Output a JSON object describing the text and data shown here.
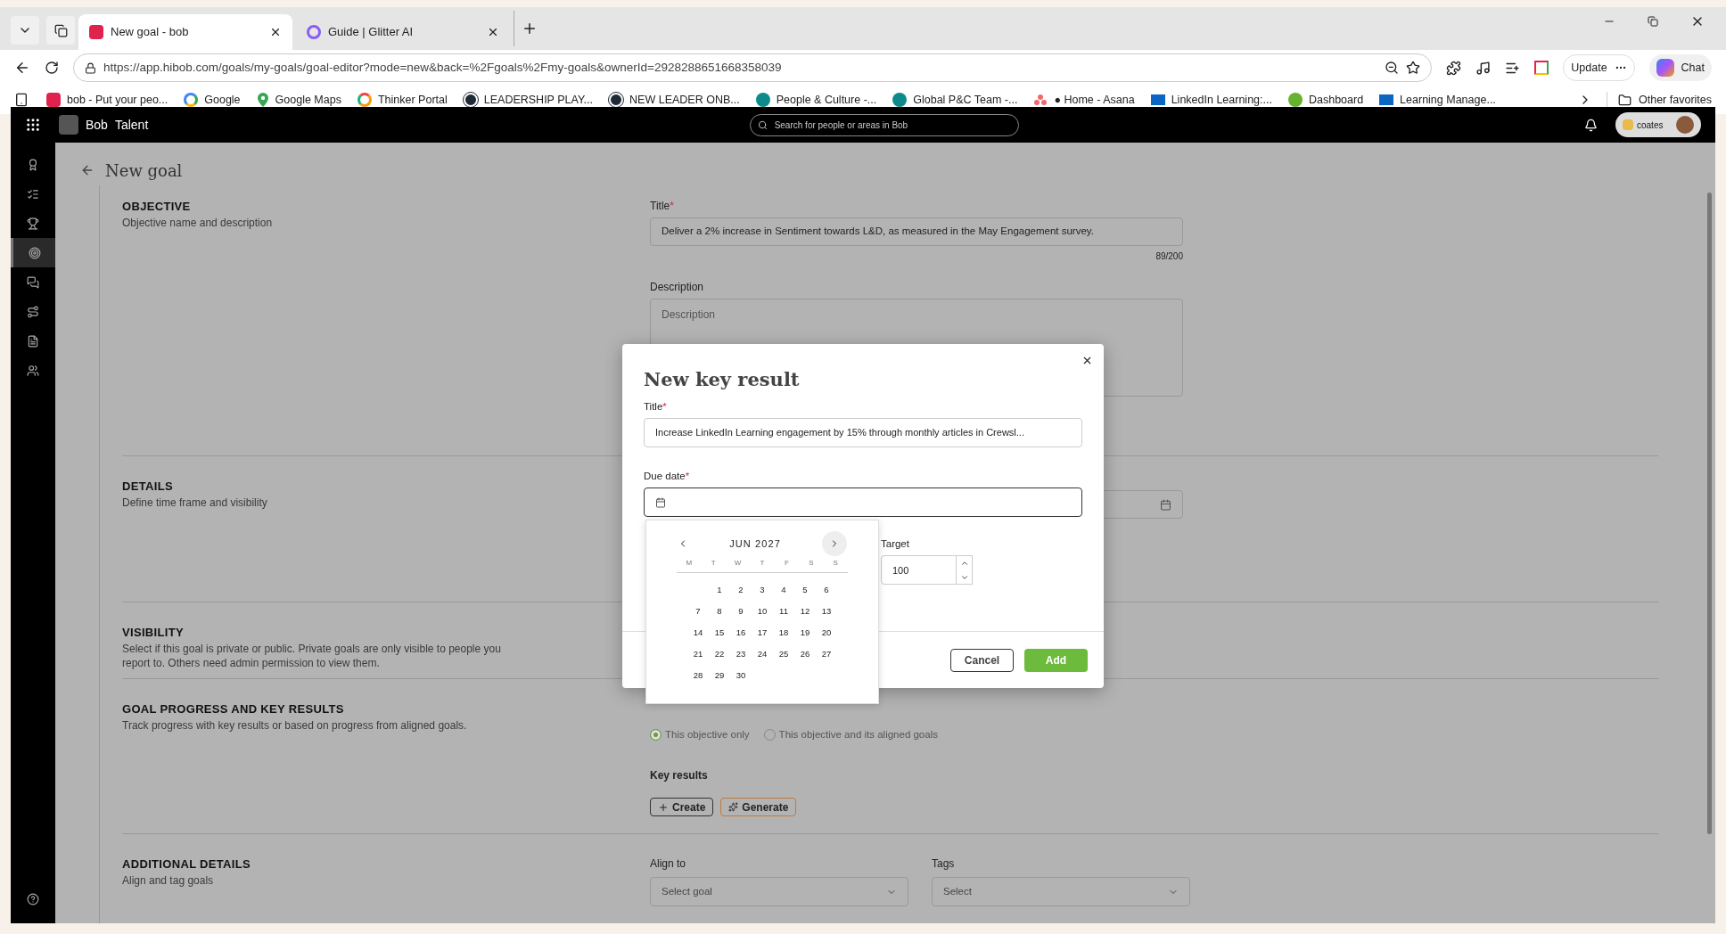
{
  "browser": {
    "tabs": [
      {
        "title": "New goal - bob",
        "selected": true,
        "kind": "bob"
      },
      {
        "title": "Guide | Glitter AI",
        "selected": false,
        "kind": "glitter"
      }
    ],
    "url": "https://app.hibob.com/goals/my-goals/goal-editor?mode=new&back=%2Fgoals%2Fmy-goals&ownerId=2928288651668358039",
    "bookmarks": [
      {
        "label": "bob - Put your peo...",
        "kind": "bob"
      },
      {
        "label": "Google",
        "kind": "google"
      },
      {
        "label": "Google Maps",
        "kind": "maps"
      },
      {
        "label": "Thinker Portal",
        "kind": "thinker"
      },
      {
        "label": "LEADERSHIP PLAY...",
        "kind": "c"
      },
      {
        "label": "NEW LEADER ONB...",
        "kind": "c"
      },
      {
        "label": "People & Culture -...",
        "kind": "sharepoint"
      },
      {
        "label": "Global P&C Team -...",
        "kind": "sharepoint"
      },
      {
        "label": "● Home - Asana",
        "kind": "asana"
      },
      {
        "label": "LinkedIn Learning:...",
        "kind": "video"
      },
      {
        "label": "Dashboard",
        "kind": "check"
      },
      {
        "label": "Learning Manage...",
        "kind": "video"
      }
    ],
    "other_favorites": "Other favorites",
    "update": "Update",
    "chat": "Chat"
  },
  "app": {
    "brand": "Bob",
    "product": "Talent",
    "search": {
      "placeholder": "Search for people or areas in Bob"
    },
    "user": "coates",
    "sidebar": [
      {
        "selected": false
      },
      {
        "selected": false
      },
      {
        "selected": false
      },
      {
        "selected": true
      },
      {
        "selected": false
      },
      {
        "selected": false
      },
      {
        "selected": false
      },
      {
        "selected": false
      }
    ],
    "page_title": "New goal",
    "objective": {
      "heading": "OBJECTIVE",
      "subtitle": "Objective name and description",
      "title_label": "Title",
      "title_required": "*",
      "title_value": "Deliver a 2% increase in Sentiment towards L&D, as measured in the May Engagement survey.",
      "counter": "89/200",
      "description_label": "Description",
      "description_placeholder": "Description"
    },
    "details": {
      "heading": "DETAILS",
      "subtitle": "Define time frame and visibility"
    },
    "visibility": {
      "heading": "VISIBILITY",
      "subtitle": "Select if this goal is private or public. Private goals are only visible to people you report to. Others need admin permission to view them."
    },
    "progress": {
      "heading": "GOAL PROGRESS AND KEY RESULTS",
      "subtitle": "Track progress with key results or based on progress from aligned goals.",
      "options": [
        {
          "label": "This objective only",
          "selected": true
        },
        {
          "label": "This objective and its aligned goals",
          "selected": false
        }
      ],
      "key_results_label": "Key results",
      "create": "Create",
      "generate": "Generate"
    },
    "additional": {
      "heading": "ADDITIONAL DETAILS",
      "subtitle": "Align and tag goals",
      "align_label": "Align to",
      "align_placeholder": "Select goal",
      "tags_label": "Tags",
      "tags_placeholder": "Select"
    }
  },
  "modal": {
    "title": "New key result",
    "title_label": "Title",
    "title_required": "*",
    "title_value": "Increase LinkedIn Learning engagement by 15% through monthly articles in Crewsl...",
    "due_label": "Due date",
    "due_required": "*",
    "target_label": "Target",
    "target_value": "100",
    "cancel": "Cancel",
    "add": "Add",
    "calendar": {
      "month": "JUN 2027",
      "weekdays": [
        "M",
        "T",
        "W",
        "T",
        "F",
        "S",
        "S"
      ],
      "weeks": [
        {
          "kind": "first",
          "days": [
            "1",
            "2",
            "3",
            "4",
            "5",
            "6"
          ]
        },
        {
          "kind": "full",
          "days": [
            "7",
            "8",
            "9",
            "10",
            "11",
            "12",
            "13"
          ]
        },
        {
          "kind": "full",
          "days": [
            "14",
            "15",
            "16",
            "17",
            "18",
            "19",
            "20"
          ]
        },
        {
          "kind": "full",
          "days": [
            "21",
            "22",
            "23",
            "24",
            "25",
            "26",
            "27"
          ]
        },
        {
          "kind": "last",
          "days": [
            "28",
            "29",
            "30"
          ]
        }
      ]
    }
  }
}
